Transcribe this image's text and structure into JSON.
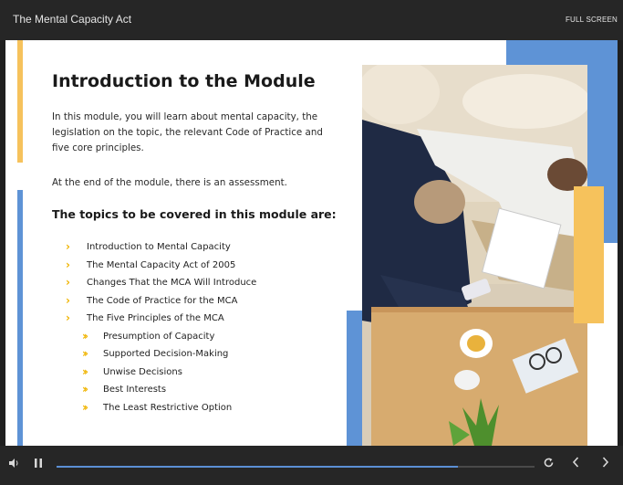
{
  "window": {
    "title": "The Mental Capacity Act",
    "fullscreen_label": "FULL SCREEN"
  },
  "slide": {
    "heading": "Introduction to the Module",
    "para1": "In this module, you will learn about mental capacity, the legislation on the topic, the relevant Code of Practice and five core principles.",
    "para2": "At the end of the module, there is an assessment.",
    "subheading": "The topics to be covered in this module are:",
    "topics": [
      {
        "label": "Introduction to Mental Capacity",
        "level": 1
      },
      {
        "label": "The Mental Capacity Act of 2005",
        "level": 1
      },
      {
        "label": "Changes That the MCA Will Introduce",
        "level": 1
      },
      {
        "label": "The Code of Practice for the MCA",
        "level": 1
      },
      {
        "label": "The Five Principles of the MCA",
        "level": 1
      },
      {
        "label": "Presumption of Capacity",
        "level": 2
      },
      {
        "label": "Supported Decision-Making",
        "level": 2
      },
      {
        "label": "Unwise Decisions",
        "level": 2
      },
      {
        "label": "Best Interests",
        "level": 2
      },
      {
        "label": "The Least Restrictive Option",
        "level": 2
      }
    ],
    "colors": {
      "accent_yellow": "#f6c25c",
      "accent_blue": "#5e93d6",
      "chevron": "#f0b400"
    }
  },
  "player": {
    "progress": 0.84,
    "icons": [
      "volume-icon",
      "pause-icon",
      "replay-icon",
      "chevron-left-icon",
      "chevron-right-icon"
    ]
  }
}
